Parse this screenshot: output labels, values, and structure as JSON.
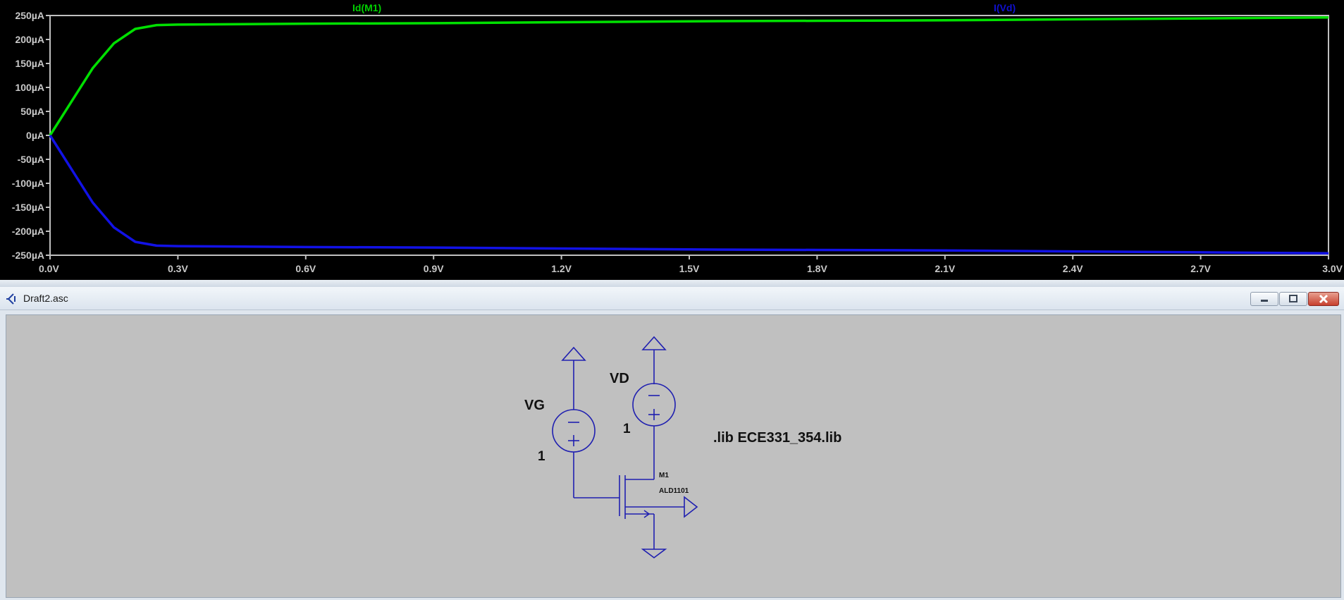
{
  "plot": {
    "trace_labels": [
      "Id(M1)",
      "I(Vd)"
    ],
    "colors": {
      "background": "#000000",
      "frame": "#c0c0c0",
      "id_trace": "#00e000",
      "ivd_trace": "#1212e6"
    },
    "y_ticks": [
      "250µA",
      "200µA",
      "150µA",
      "100µA",
      "50µA",
      "0µA",
      "-50µA",
      "-100µA",
      "-150µA",
      "-200µA",
      "-250µA"
    ],
    "x_ticks": [
      "0.0V",
      "0.3V",
      "0.6V",
      "0.9V",
      "1.2V",
      "1.5V",
      "1.8V",
      "2.1V",
      "2.4V",
      "2.7V",
      "3.0V"
    ]
  },
  "chart_data": {
    "type": "line",
    "xlim": [
      0,
      3.0
    ],
    "ylim": [
      -250,
      250
    ],
    "grid": false,
    "series": [
      {
        "name": "Id(M1)",
        "color": "#00e000",
        "x": [
          0,
          0.05,
          0.1,
          0.15,
          0.2,
          0.25,
          0.3,
          0.6,
          0.9,
          1.2,
          1.5,
          1.8,
          2.1,
          2.4,
          2.7,
          3.0
        ],
        "values": [
          0,
          70,
          140,
          192,
          222,
          230,
          231,
          233,
          234,
          236,
          238,
          239,
          240,
          242,
          244,
          246
        ]
      },
      {
        "name": "I(Vd)",
        "color": "#1212e6",
        "x": [
          0,
          0.05,
          0.1,
          0.15,
          0.2,
          0.25,
          0.3,
          0.6,
          0.9,
          1.2,
          1.5,
          1.8,
          2.1,
          2.4,
          2.7,
          3.0
        ],
        "values": [
          0,
          -70,
          -140,
          -192,
          -222,
          -230,
          -231,
          -233,
          -234,
          -236,
          -238,
          -239,
          -240,
          -242,
          -244,
          -246
        ]
      }
    ]
  },
  "window": {
    "title": "Draft2.asc"
  },
  "schematic": {
    "vg_name": "VG",
    "vg_value": "1",
    "vd_name": "VD",
    "vd_value": "1",
    "m1_name": "M1",
    "m1_model": "ALD1101",
    "directive": ".lib ECE331_354.lib",
    "wire_color": "#1f1fb0"
  }
}
